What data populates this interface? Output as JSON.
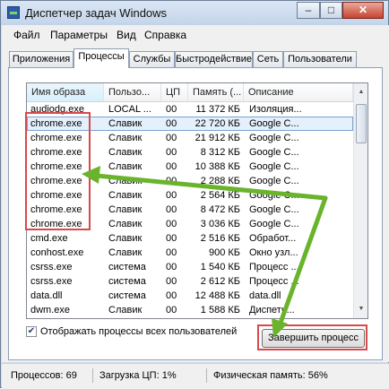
{
  "window": {
    "title": "Диспетчер задач Windows",
    "min_label": "–",
    "max_label": "□",
    "close_label": "✕"
  },
  "menu": [
    "Файл",
    "Параметры",
    "Вид",
    "Справка"
  ],
  "tabs": [
    "Приложения",
    "Процессы",
    "Службы",
    "Быстродействие",
    "Сеть",
    "Пользователи"
  ],
  "active_tab": "Процессы",
  "columns": [
    "Имя образа",
    "Пользо...",
    "ЦП",
    "Память (...",
    "Описание"
  ],
  "rows": [
    {
      "name": "audiodg.exe",
      "user": "LOCAL ...",
      "cpu": "00",
      "mem": "11 372 КБ",
      "desc": "Изоляция..."
    },
    {
      "name": "chrome.exe",
      "user": "Славик",
      "cpu": "00",
      "mem": "22 720 КБ",
      "desc": "Google C..."
    },
    {
      "name": "chrome.exe",
      "user": "Славик",
      "cpu": "00",
      "mem": "21 912 КБ",
      "desc": "Google C..."
    },
    {
      "name": "chrome.exe",
      "user": "Славик",
      "cpu": "00",
      "mem": "8 312 КБ",
      "desc": "Google C..."
    },
    {
      "name": "chrome.exe",
      "user": "Славик",
      "cpu": "00",
      "mem": "10 388 КБ",
      "desc": "Google C..."
    },
    {
      "name": "chrome.exe",
      "user": "Славик",
      "cpu": "00",
      "mem": "2 288 КБ",
      "desc": "Google C..."
    },
    {
      "name": "chrome.exe",
      "user": "Славик",
      "cpu": "00",
      "mem": "2 564 КБ",
      "desc": "Google C..."
    },
    {
      "name": "chrome.exe",
      "user": "Славик",
      "cpu": "00",
      "mem": "8 472 КБ",
      "desc": "Google C..."
    },
    {
      "name": "chrome.exe",
      "user": "Славик",
      "cpu": "00",
      "mem": "3 036 КБ",
      "desc": "Google C..."
    },
    {
      "name": "cmd.exe",
      "user": "Славик",
      "cpu": "00",
      "mem": "2 516 КБ",
      "desc": "Обработ..."
    },
    {
      "name": "conhost.exe",
      "user": "Славик",
      "cpu": "00",
      "mem": "900 КБ",
      "desc": "Окно узл..."
    },
    {
      "name": "csrss.exe",
      "user": "система",
      "cpu": "00",
      "mem": "1 540 КБ",
      "desc": "Процесс ..."
    },
    {
      "name": "csrss.exe",
      "user": "система",
      "cpu": "00",
      "mem": "2 612 КБ",
      "desc": "Процесс ..."
    },
    {
      "name": "data.dll",
      "user": "система",
      "cpu": "00",
      "mem": "12 488 КБ",
      "desc": "data.dll"
    },
    {
      "name": "dwm.exe",
      "user": "Славик",
      "cpu": "00",
      "mem": "1 588 КБ",
      "desc": "Диспетч..."
    }
  ],
  "selected_row": 1,
  "show_all_label": "Отображать процессы всех пользователей",
  "show_all_checked": true,
  "end_button": "Завершить процесс",
  "status": {
    "processes": "Процессов: 69",
    "cpu": "Загрузка ЦП: 1%",
    "memory": "Физическая память: 56%"
  },
  "colors": {
    "highlight_red": "#d9494b",
    "arrow_green": "#6ab42d",
    "selection": "#e4f0fb"
  }
}
